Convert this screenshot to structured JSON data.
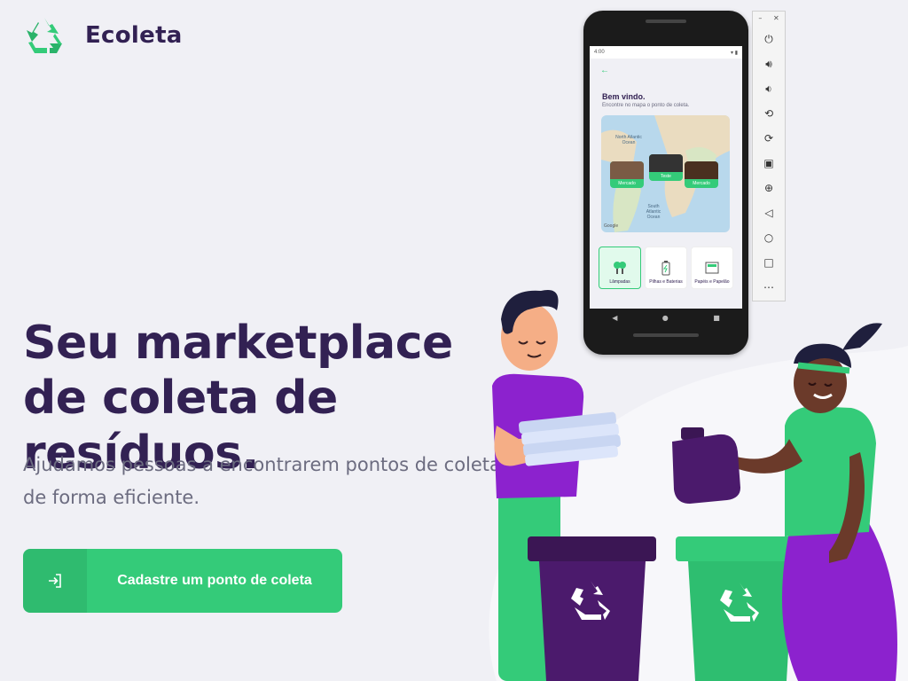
{
  "logo": {
    "text": "Ecoleta",
    "icon": "recycle-icon",
    "color": "#34CB79"
  },
  "hero": {
    "title": "Seu marketplace de coleta de resíduos.",
    "subtitle": "Ajudamos pessoas a encontrarem pontos de coleta de forma eficiente."
  },
  "cta": {
    "label": "Cadastre um ponto de coleta",
    "icon": "login-arrow-icon"
  },
  "colors": {
    "primary": "#34CB79",
    "title": "#322153",
    "text": "#6C6C80",
    "background": "#F0F0F5"
  },
  "phone": {
    "status_time": "4:00",
    "back_icon": "arrow-left-icon",
    "welcome": "Bem vindo.",
    "welcome_sub": "Encontre no mapa o ponto de coleta.",
    "map_labels": {
      "north_atlantic": "North Atlantic Ocean",
      "south_atlantic": "South Atlantic Ocean",
      "google": "Google"
    },
    "markers": [
      "Mercado",
      "Teste",
      "Mercado"
    ],
    "items": [
      {
        "label": "Lâmpadas",
        "selected": true
      },
      {
        "label": "Pilhas e Baterias",
        "selected": false
      },
      {
        "label": "Papéis e Papelão",
        "selected": false
      }
    ]
  },
  "emulator": {
    "buttons": [
      "power-icon",
      "volume-up-icon",
      "volume-down-icon",
      "rotate-left-icon",
      "rotate-right-icon",
      "camera-icon",
      "zoom-icon",
      "back-icon",
      "home-icon",
      "overview-icon",
      "more-icon"
    ]
  }
}
